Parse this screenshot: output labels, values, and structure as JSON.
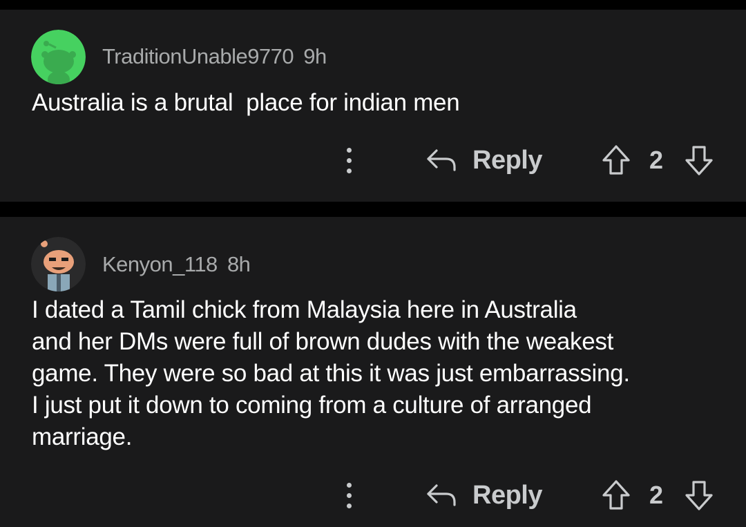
{
  "comments": [
    {
      "username": "TraditionUnable9770",
      "time": "9h",
      "body": "Australia is a brutal  place for indian men",
      "reply_label": "Reply",
      "score": "2",
      "avatar_color": "#46d160"
    },
    {
      "username": "Kenyon_118",
      "time": "8h",
      "body": "I dated a Tamil chick from Malaysia here in Australia\nand her DMs were full of brown dudes with the weakest\ngame. They were so bad at this it was just embarrassing.\nI just put it down to coming from a culture of arranged\nmarriage.",
      "reply_label": "Reply",
      "score": "2",
      "avatar_color": "#2a2a2b"
    }
  ],
  "colors": {
    "background": "#000000",
    "card": "#1a1a1b",
    "meta_text": "#a8aaab",
    "body_text": "#ffffff",
    "action_text": "#c9cbcd"
  },
  "icons": [
    "snoo-avatar-icon",
    "custom-avatar-icon",
    "more-options-icon",
    "reply-arrow-icon",
    "upvote-arrow-icon",
    "downvote-arrow-icon"
  ]
}
